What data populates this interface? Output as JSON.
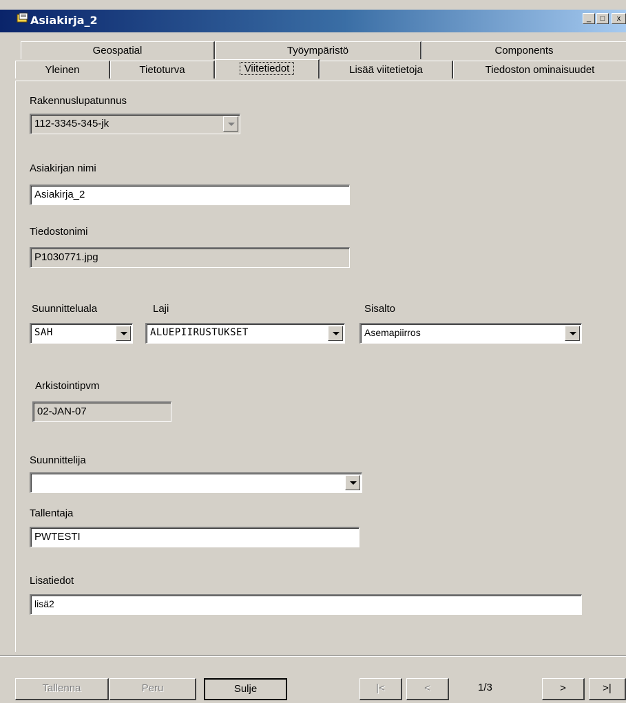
{
  "window": {
    "title": "Asiakirja_2",
    "controls": [
      "_",
      "□",
      "x"
    ]
  },
  "tabs": {
    "row1": [
      "Geospatial",
      "Työympäristö",
      "Components"
    ],
    "row2": [
      "Yleinen",
      "Tietoturva",
      "Viitetiedot",
      "Lisää viitetietoja",
      "Tiedoston ominaisuudet"
    ],
    "active": "Viitetiedot"
  },
  "form": {
    "rakennuslupatunnus": {
      "label": "Rakennuslupatunnus",
      "value": "112-3345-345-jk"
    },
    "asiakirjan_nimi": {
      "label": "Asiakirjan nimi",
      "value": "Asiakirja_2"
    },
    "tiedostonimi": {
      "label": "Tiedostonimi",
      "value": "P1030771.jpg"
    },
    "suunnitteluala": {
      "label": "Suunnitteluala",
      "value": "SAH"
    },
    "laji": {
      "label": "Laji",
      "value": "ALUEPIIRUSTUKSET"
    },
    "sisalto": {
      "label": "Sisalto",
      "value": "Asemapiirros"
    },
    "arkistointipvm": {
      "label": "Arkistointipvm",
      "value": "02-JAN-07"
    },
    "suunnittelija": {
      "label": "Suunnittelija",
      "value": ""
    },
    "tallentaja": {
      "label": "Tallentaja",
      "value": "PWTESTI"
    },
    "lisatiedot": {
      "label": "Lisatiedot",
      "value": "lisä2"
    }
  },
  "buttons": {
    "save": "Tallenna",
    "cancel": "Peru",
    "close": "Sulje",
    "first": "|<",
    "prev": "<",
    "next": ">",
    "last": ">|"
  },
  "pagination": {
    "page": "1/3"
  }
}
